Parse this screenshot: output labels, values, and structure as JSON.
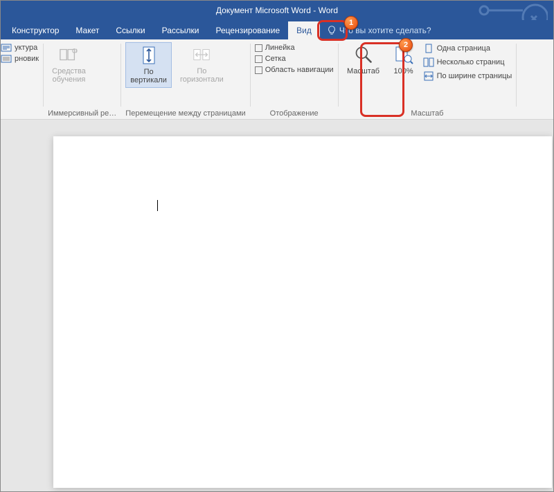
{
  "title": "Документ Microsoft Word  -  Word",
  "tabs": {
    "constructor": "Конструктор",
    "layout": "Макет",
    "references": "Ссылки",
    "mailings": "Рассылки",
    "review": "Рецензирование",
    "view": "Вид"
  },
  "tellme": {
    "placeholder": "Что вы хотите сделать?"
  },
  "views_group": {
    "structure": "уктура",
    "draft": "рновик"
  },
  "immersive_group": {
    "btn": "Средства\nобучения",
    "label": "Иммерсивный ре…"
  },
  "pagemove_group": {
    "vertical": "По\nвертикали",
    "horizontal": "По\nгоризонтали",
    "label": "Перемещение между страницами"
  },
  "show_group": {
    "ruler": "Линейка",
    "grid": "Сетка",
    "nav": "Область навигации",
    "label": "Отображение"
  },
  "zoom_group": {
    "zoom": "Масштаб",
    "hundred": "100%",
    "one_page": "Одна страница",
    "multi_page": "Несколько страниц",
    "page_width": "По ширине страницы",
    "label": "Масштаб"
  },
  "callouts": {
    "c1": "1",
    "c2": "2"
  }
}
